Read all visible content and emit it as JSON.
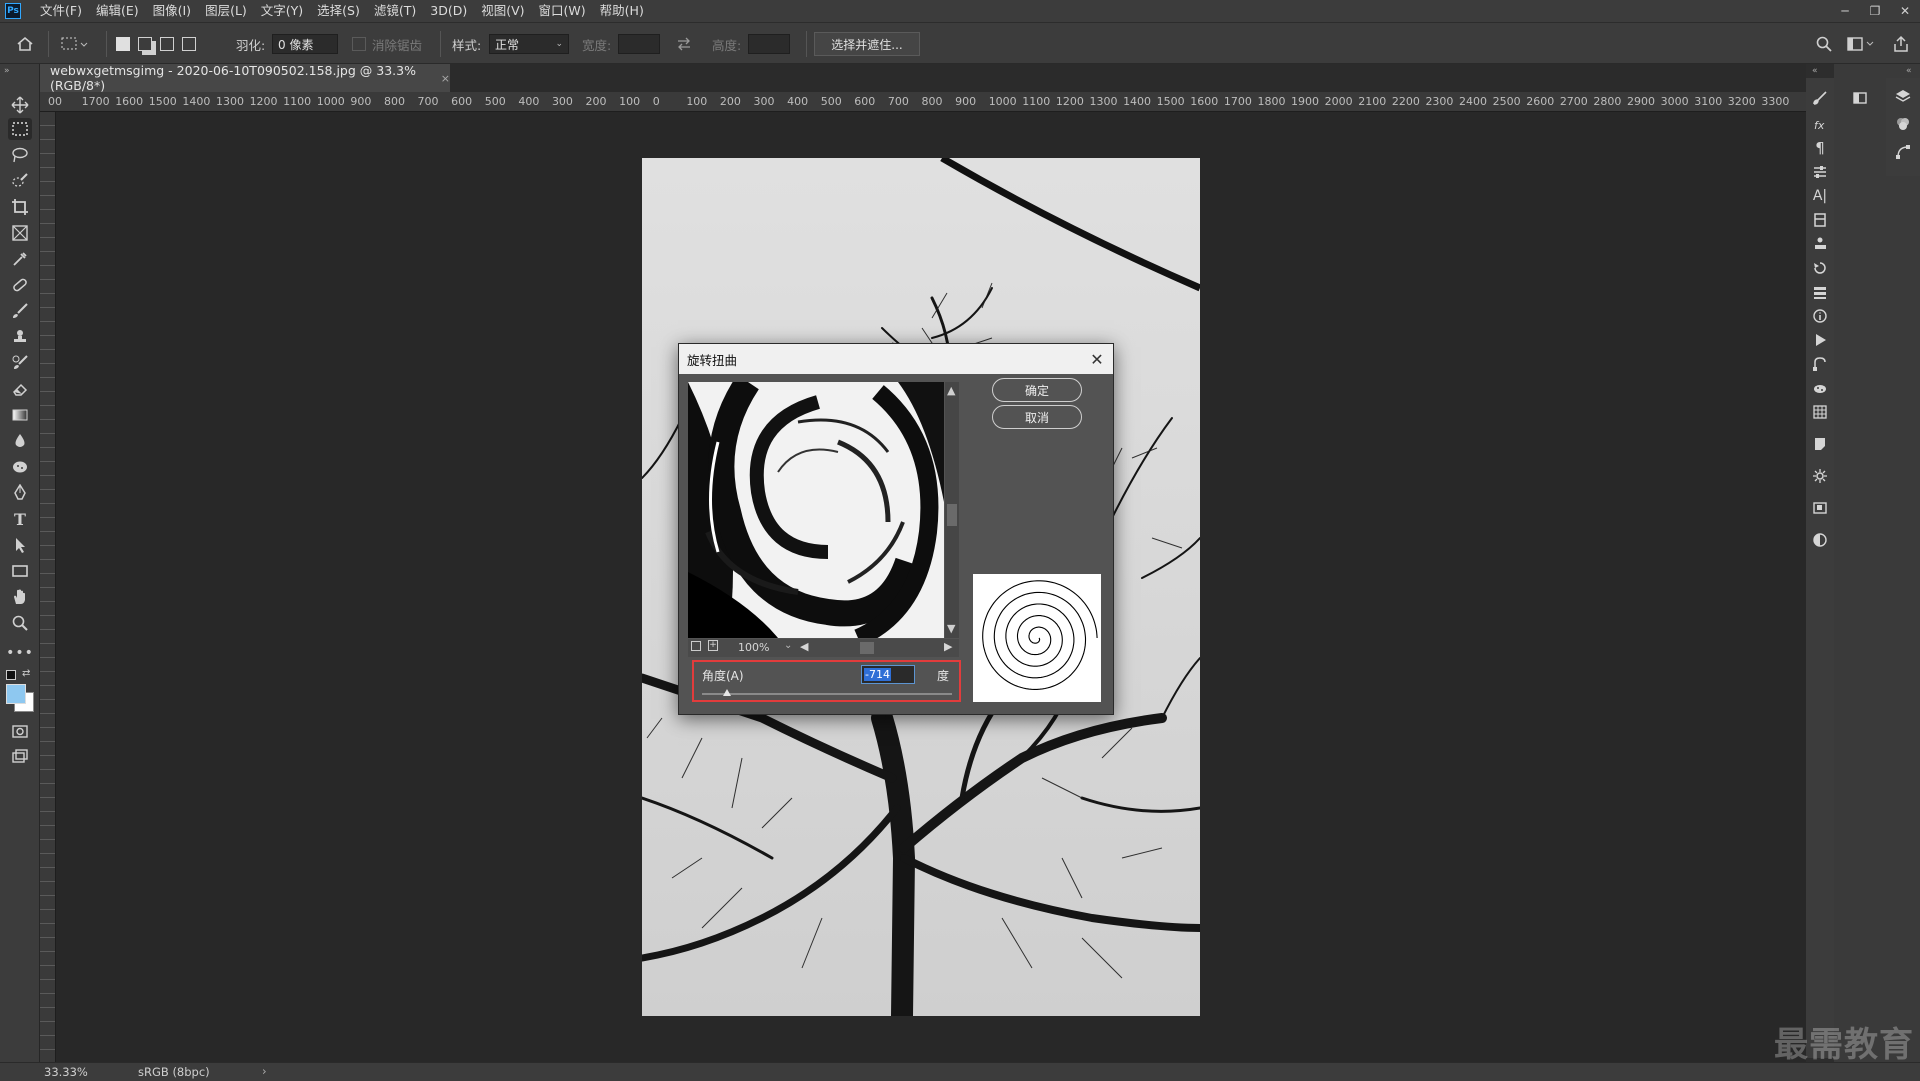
{
  "menubar": {
    "logo": "Ps",
    "items": [
      "文件(F)",
      "编辑(E)",
      "图像(I)",
      "图层(L)",
      "文字(Y)",
      "选择(S)",
      "滤镜(T)",
      "3D(D)",
      "视图(V)",
      "窗口(W)",
      "帮助(H)"
    ]
  },
  "optionsbar": {
    "feather_label": "羽化:",
    "feather_value": "0 像素",
    "antialias_label": "消除锯齿",
    "style_label": "样式:",
    "style_value": "正常",
    "width_label": "宽度:",
    "height_label": "高度:",
    "select_mask_label": "选择并遮住..."
  },
  "document": {
    "tab_title": "webwxgetmsgimg - 2020-06-10T090502.158.jpg @ 33.3%(RGB/8*)",
    "tab_close": "×"
  },
  "ruler": {
    "h_labels": [
      "00",
      "1700",
      "1600",
      "1500",
      "1400",
      "1300",
      "1200",
      "1100",
      "1000",
      "900",
      "800",
      "700",
      "600",
      "500",
      "400",
      "300",
      "200",
      "100",
      "0",
      "100",
      "200",
      "300",
      "400",
      "500",
      "600",
      "700",
      "800",
      "900",
      "1000",
      "1100",
      "1200",
      "1300",
      "1400",
      "1500",
      "1600",
      "1700",
      "1800",
      "1900",
      "2000",
      "2100",
      "2200",
      "2300",
      "2400",
      "2500",
      "2600",
      "2700",
      "2800",
      "2900",
      "3000",
      "3100",
      "3200",
      "3300"
    ]
  },
  "dialog": {
    "title": "旋转扭曲",
    "ok_label": "确定",
    "cancel_label": "取消",
    "zoom_value": "100%",
    "angle_label": "角度(A)",
    "angle_value": "-714",
    "angle_unit": "度",
    "angle_slider_fraction": 0.1
  },
  "statusbar": {
    "zoom": "33.33%",
    "color_profile": "sRGB (8bpc)"
  },
  "watermark": "最需教育",
  "colors": {
    "foreground": "#8ec8f0",
    "background": "#ffffff",
    "highlight_box": "#e23c3c",
    "selection": "#2f6fd6"
  }
}
